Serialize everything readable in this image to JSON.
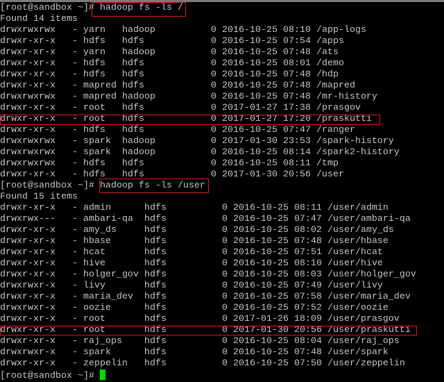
{
  "prompt": "[root@sandbox ~]# ",
  "listings": [
    {
      "command": "hadoop fs -ls /",
      "found": "Found 14 items",
      "owner_width": 6,
      "size_col": 38,
      "rows": [
        {
          "perms": "drwxrwxrwx",
          "repl": "-",
          "owner": "yarn",
          "group": "hadoop",
          "size": "0",
          "date": "2016-10-25",
          "time": "08:10",
          "path": "/app-logs"
        },
        {
          "perms": "drwxr-xr-x",
          "repl": "-",
          "owner": "hdfs",
          "group": "hdfs",
          "size": "0",
          "date": "2016-10-25",
          "time": "07:54",
          "path": "/apps"
        },
        {
          "perms": "drwxr-xr-x",
          "repl": "-",
          "owner": "yarn",
          "group": "hadoop",
          "size": "0",
          "date": "2016-10-25",
          "time": "07:48",
          "path": "/ats"
        },
        {
          "perms": "drwxr-xr-x",
          "repl": "-",
          "owner": "hdfs",
          "group": "hdfs",
          "size": "0",
          "date": "2016-10-25",
          "time": "08:01",
          "path": "/demo"
        },
        {
          "perms": "drwxr-xr-x",
          "repl": "-",
          "owner": "hdfs",
          "group": "hdfs",
          "size": "0",
          "date": "2016-10-25",
          "time": "07:48",
          "path": "/hdp"
        },
        {
          "perms": "drwxr-xr-x",
          "repl": "-",
          "owner": "mapred",
          "group": "hdfs",
          "size": "0",
          "date": "2016-10-25",
          "time": "07:48",
          "path": "/mapred"
        },
        {
          "perms": "drwxrwxrwx",
          "repl": "-",
          "owner": "mapred",
          "group": "hadoop",
          "size": "0",
          "date": "2016-10-25",
          "time": "07:48",
          "path": "/mr-history"
        },
        {
          "perms": "drwxr-xr-x",
          "repl": "-",
          "owner": "root",
          "group": "hdfs",
          "size": "0",
          "date": "2017-01-27",
          "time": "17:38",
          "path": "/prasgov"
        },
        {
          "perms": "drwxr-xr-x",
          "repl": "-",
          "owner": "root",
          "group": "hdfs",
          "size": "0",
          "date": "2017-01-27",
          "time": "17:20",
          "path": "/praskutti",
          "highlighted": true
        },
        {
          "perms": "drwxr-xr-x",
          "repl": "-",
          "owner": "hdfs",
          "group": "hdfs",
          "size": "0",
          "date": "2016-10-25",
          "time": "07:47",
          "path": "/ranger"
        },
        {
          "perms": "drwxrwxrwx",
          "repl": "-",
          "owner": "spark",
          "group": "hadoop",
          "size": "0",
          "date": "2017-01-30",
          "time": "23:53",
          "path": "/spark-history"
        },
        {
          "perms": "drwxrwxrwx",
          "repl": "-",
          "owner": "spark",
          "group": "hadoop",
          "size": "0",
          "date": "2016-10-25",
          "time": "08:14",
          "path": "/spark2-history"
        },
        {
          "perms": "drwxrwxrwx",
          "repl": "-",
          "owner": "hdfs",
          "group": "hdfs",
          "size": "0",
          "date": "2016-10-25",
          "time": "08:11",
          "path": "/tmp"
        },
        {
          "perms": "drwxr-xr-x",
          "repl": "-",
          "owner": "hdfs",
          "group": "hdfs",
          "size": "0",
          "date": "2017-01-30",
          "time": "20:56",
          "path": "/user"
        }
      ]
    },
    {
      "command": "hadoop fs -ls /user",
      "found": "Found 15 items",
      "owner_width": 10,
      "size_col": 40,
      "rows": [
        {
          "perms": "drwxr-xr-x",
          "repl": "-",
          "owner": "admin",
          "group": "hdfs",
          "size": "0",
          "date": "2016-10-25",
          "time": "08:11",
          "path": "/user/admin"
        },
        {
          "perms": "drwxrwx---",
          "repl": "-",
          "owner": "ambari-qa",
          "group": "hdfs",
          "size": "0",
          "date": "2016-10-25",
          "time": "07:47",
          "path": "/user/ambari-qa"
        },
        {
          "perms": "drwxr-xr-x",
          "repl": "-",
          "owner": "amy_ds",
          "group": "hdfs",
          "size": "0",
          "date": "2016-10-25",
          "time": "08:02",
          "path": "/user/amy_ds"
        },
        {
          "perms": "drwxr-xr-x",
          "repl": "-",
          "owner": "hbase",
          "group": "hdfs",
          "size": "0",
          "date": "2016-10-25",
          "time": "07:48",
          "path": "/user/hbase"
        },
        {
          "perms": "drwxr-xr-x",
          "repl": "-",
          "owner": "hcat",
          "group": "hdfs",
          "size": "0",
          "date": "2016-10-25",
          "time": "07:51",
          "path": "/user/hcat"
        },
        {
          "perms": "drwxr-xr-x",
          "repl": "-",
          "owner": "hive",
          "group": "hdfs",
          "size": "0",
          "date": "2016-10-25",
          "time": "08:10",
          "path": "/user/hive"
        },
        {
          "perms": "drwxr-xr-x",
          "repl": "-",
          "owner": "holger_gov",
          "group": "hdfs",
          "size": "0",
          "date": "2016-10-25",
          "time": "08:03",
          "path": "/user/holger_gov"
        },
        {
          "perms": "drwxrwxr-x",
          "repl": "-",
          "owner": "livy",
          "group": "hdfs",
          "size": "0",
          "date": "2016-10-25",
          "time": "07:49",
          "path": "/user/livy"
        },
        {
          "perms": "drwxr-xr-x",
          "repl": "-",
          "owner": "maria_dev",
          "group": "hdfs",
          "size": "0",
          "date": "2016-10-25",
          "time": "07:58",
          "path": "/user/maria_dev"
        },
        {
          "perms": "drwxrwxr-x",
          "repl": "-",
          "owner": "oozie",
          "group": "hdfs",
          "size": "0",
          "date": "2016-10-25",
          "time": "07:52",
          "path": "/user/oozie"
        },
        {
          "perms": "drwxr-xr-x",
          "repl": "-",
          "owner": "root",
          "group": "hdfs",
          "size": "0",
          "date": "2017-01-26",
          "time": "18:09",
          "path": "/user/prasgov"
        },
        {
          "perms": "drwxr-xr-x",
          "repl": "-",
          "owner": "root",
          "group": "hdfs",
          "size": "0",
          "date": "2017-01-30",
          "time": "20:56",
          "path": "/user/praskutti",
          "highlighted": true
        },
        {
          "perms": "drwxr-xr-x",
          "repl": "-",
          "owner": "raj_ops",
          "group": "hdfs",
          "size": "0",
          "date": "2016-10-25",
          "time": "08:04",
          "path": "/user/raj_ops"
        },
        {
          "perms": "drwxrwxr-x",
          "repl": "-",
          "owner": "spark",
          "group": "hdfs",
          "size": "0",
          "date": "2016-10-25",
          "time": "07:48",
          "path": "/user/spark"
        },
        {
          "perms": "drwxr-xr-x",
          "repl": "-",
          "owner": "zeppelin",
          "group": "hdfs",
          "size": "0",
          "date": "2016-10-25",
          "time": "07:50",
          "path": "/user/zeppelin"
        }
      ]
    }
  ],
  "colors": {
    "text": "#c6c6c6",
    "highlight_box": "#e0191f",
    "cursor": "#00e000"
  }
}
